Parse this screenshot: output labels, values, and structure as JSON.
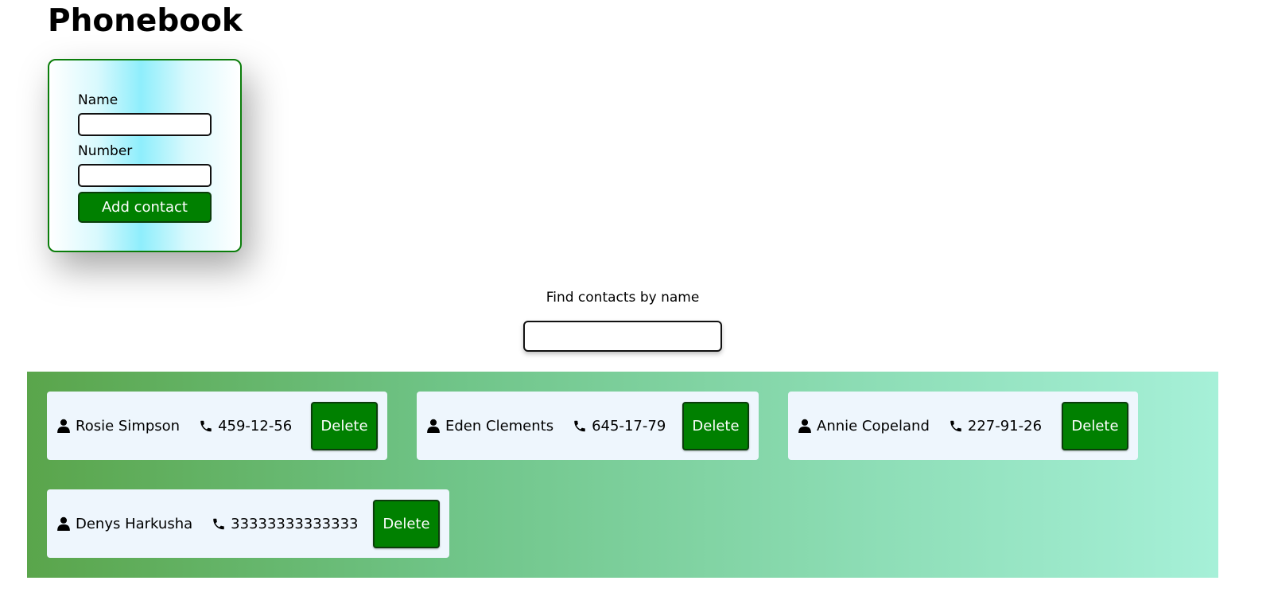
{
  "page": {
    "title": "Phonebook"
  },
  "form": {
    "name_label": "Name",
    "name_value": "",
    "number_label": "Number",
    "number_value": "",
    "submit_label": "Add contact"
  },
  "filter": {
    "label": "Find contacts by name",
    "value": ""
  },
  "colors": {
    "accent_green": "#008000",
    "card_background": "#eef6fd",
    "form_border": "#0b7d0b"
  },
  "icons": {
    "name": "user-icon",
    "number": "phone-icon"
  },
  "contacts": [
    {
      "name": "Rosie Simpson",
      "number": "459-12-56",
      "delete_label": "Delete"
    },
    {
      "name": "Eden Clements",
      "number": "645-17-79",
      "delete_label": "Delete"
    },
    {
      "name": "Annie Copeland",
      "number": "227-91-26",
      "delete_label": "Delete"
    },
    {
      "name": "Denys Harkusha",
      "number": "33333333333333",
      "delete_label": "Delete"
    }
  ]
}
